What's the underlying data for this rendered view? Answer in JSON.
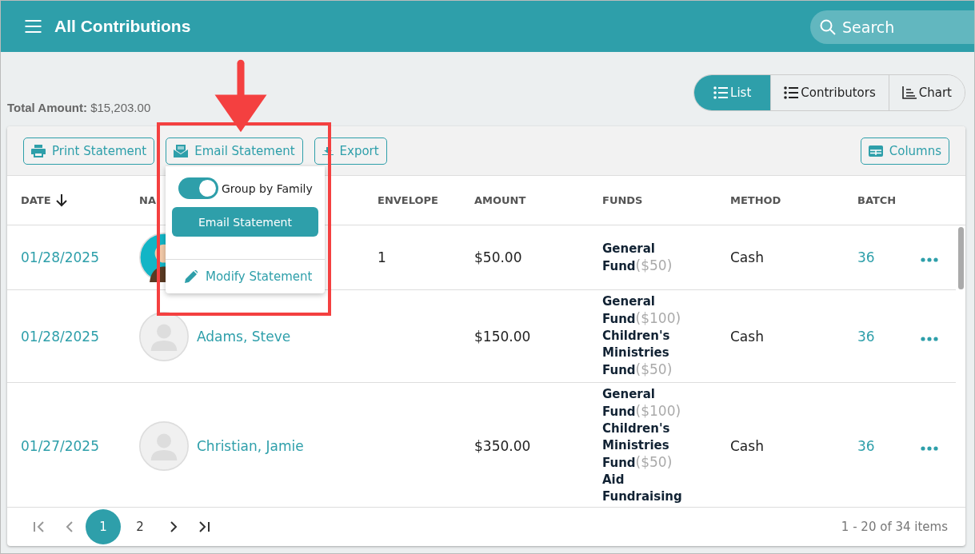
{
  "header": {
    "title": "All Contributions",
    "search": {
      "placeholder": "Search"
    }
  },
  "total": {
    "label": "Total Amount:",
    "value": "$15,203.00"
  },
  "views": [
    {
      "label": "List",
      "selected": true
    },
    {
      "label": "Contributors",
      "selected": false
    },
    {
      "label": "Chart",
      "selected": false
    }
  ],
  "toolbar": [
    "Print Statement",
    "Email Statement",
    "Export"
  ],
  "columns_button": "Columns",
  "dropdown": {
    "toggle": {
      "label": "Group by Family",
      "on": true
    },
    "action": "Email Statement",
    "link": "Modify Statement"
  },
  "table": {
    "columns": [
      {
        "label": "DATE",
        "sorted": true
      },
      {
        "label": "NA",
        "sorted": false
      },
      {
        "label": "ENVELOPE",
        "sorted": false
      },
      {
        "label": "AMOUNT",
        "sorted": false
      },
      {
        "label": "FUNDS",
        "sorted": false
      },
      {
        "label": "METHOD",
        "sorted": false
      },
      {
        "label": "BATCH",
        "sorted": false
      }
    ],
    "rows": [
      {
        "date": "01/28/2025",
        "envelope": "1",
        "amount": "$50.00",
        "funds": [
          {
            "name": "General Fund",
            "amount": "($50)"
          }
        ],
        "method": "Cash",
        "batch": "36"
      },
      {
        "date": "01/28/2025",
        "name": "Adams, Steve",
        "amount": "$150.00",
        "funds": [
          {
            "name": "General Fund",
            "amount": "($100)"
          },
          {
            "name": "Children's Ministries Fund",
            "amount": "($50)"
          }
        ],
        "method": "Cash",
        "batch": "36"
      },
      {
        "date": "01/27/2025",
        "name": "Christian, Jamie",
        "amount": "$350.00",
        "funds": [
          {
            "name": "General Fund",
            "amount": "($100)"
          },
          {
            "name": "Children's Ministries Fund",
            "amount": "($50)"
          },
          {
            "name": "Aid Fundraising"
          }
        ],
        "method": "Cash",
        "batch": "36"
      }
    ]
  },
  "pagination": {
    "pages": [
      {
        "label": "1",
        "selected": true
      },
      {
        "label": "2",
        "selected": false
      }
    ],
    "summary": "1 - 20 of 34 items"
  }
}
